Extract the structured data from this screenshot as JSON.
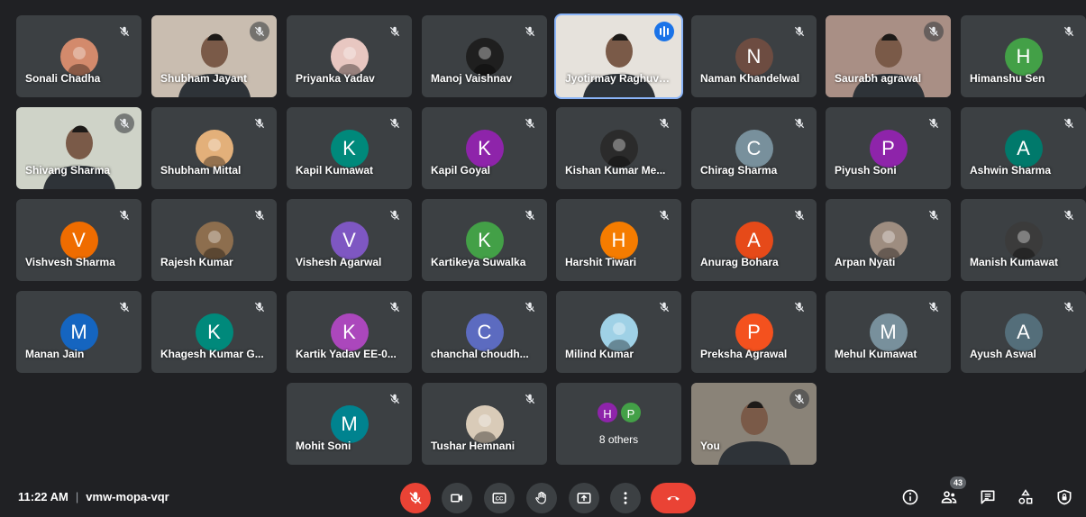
{
  "participants": [
    {
      "name": "Sonali Chadha",
      "kind": "photo",
      "avatar_bg": "#d38a6c",
      "muted": true
    },
    {
      "name": "Shubham Jayant",
      "kind": "video",
      "video_bg": "#c9bdb0",
      "muted": true
    },
    {
      "name": "Priyanka Yadav",
      "kind": "photo",
      "avatar_bg": "#e8c7c1",
      "muted": true
    },
    {
      "name": "Manoj Vaishnav",
      "kind": "photo",
      "avatar_bg": "#1f1f1f",
      "muted": true
    },
    {
      "name": "Jyotirmay Raghuvanshi",
      "kind": "video",
      "video_bg": "#e6e2dc",
      "muted": false,
      "speaking": true
    },
    {
      "name": "Naman Khandelwal",
      "kind": "initial",
      "initial": "N",
      "avatar_bg": "#6d4c41",
      "muted": true
    },
    {
      "name": "Saurabh agrawal",
      "kind": "video",
      "video_bg": "#a98f85",
      "muted": true
    },
    {
      "name": "Himanshu Sen",
      "kind": "initial",
      "initial": "H",
      "avatar_bg": "#43a047",
      "muted": true
    },
    {
      "name": "Shivang Sharma",
      "kind": "video",
      "video_bg": "#cfd3c8",
      "muted": true
    },
    {
      "name": "Shubham Mittal",
      "kind": "photo",
      "avatar_bg": "#e3b07a",
      "muted": true
    },
    {
      "name": "Kapil Kumawat",
      "kind": "initial",
      "initial": "K",
      "avatar_bg": "#00897b",
      "muted": true
    },
    {
      "name": "Kapil Goyal",
      "kind": "initial",
      "initial": "K",
      "avatar_bg": "#8e24aa",
      "muted": true
    },
    {
      "name": "Kishan Kumar Me...",
      "kind": "photo",
      "avatar_bg": "#2b2b2b",
      "muted": true
    },
    {
      "name": "Chirag Sharma",
      "kind": "initial",
      "initial": "C",
      "avatar_bg": "#78909c",
      "muted": true
    },
    {
      "name": "Piyush Soni",
      "kind": "initial",
      "initial": "P",
      "avatar_bg": "#8e24aa",
      "muted": true
    },
    {
      "name": "Ashwin Sharma",
      "kind": "initial",
      "initial": "A",
      "avatar_bg": "#00796b",
      "muted": true
    },
    {
      "name": "Vishvesh Sharma",
      "kind": "initial",
      "initial": "V",
      "avatar_bg": "#ef6c00",
      "muted": true
    },
    {
      "name": "Rajesh Kumar",
      "kind": "photo",
      "avatar_bg": "#8d6e4e",
      "muted": true
    },
    {
      "name": "Vishesh Agarwal",
      "kind": "initial",
      "initial": "V",
      "avatar_bg": "#7e57c2",
      "muted": true
    },
    {
      "name": "Kartikeya Suwalka",
      "kind": "initial",
      "initial": "K",
      "avatar_bg": "#43a047",
      "muted": true
    },
    {
      "name": "Harshit Tiwari",
      "kind": "initial",
      "initial": "H",
      "avatar_bg": "#f57c00",
      "muted": true
    },
    {
      "name": "Anurag Bohara",
      "kind": "initial",
      "initial": "A",
      "avatar_bg": "#e64a19",
      "muted": true
    },
    {
      "name": "Arpan Nyati",
      "kind": "photo",
      "avatar_bg": "#9e8d80",
      "muted": true
    },
    {
      "name": "Manish Kumawat",
      "kind": "photo",
      "avatar_bg": "#3b3b3b",
      "muted": true
    },
    {
      "name": "Manan Jain",
      "kind": "initial",
      "initial": "M",
      "avatar_bg": "#1565c0",
      "muted": true
    },
    {
      "name": "Khagesh Kumar G...",
      "kind": "initial",
      "initial": "K",
      "avatar_bg": "#00897b",
      "muted": true
    },
    {
      "name": "Kartik Yadav EE-0...",
      "kind": "initial",
      "initial": "K",
      "avatar_bg": "#ab47bc",
      "muted": true
    },
    {
      "name": "chanchal choudh...",
      "kind": "initial",
      "initial": "C",
      "avatar_bg": "#5c6bc0",
      "muted": true
    },
    {
      "name": "Milind Kumar",
      "kind": "photo",
      "avatar_bg": "#9fd1e6",
      "muted": true
    },
    {
      "name": "Preksha Agrawal",
      "kind": "initial",
      "initial": "P",
      "avatar_bg": "#f4511e",
      "muted": true
    },
    {
      "name": "Mehul Kumawat",
      "kind": "initial",
      "initial": "M",
      "avatar_bg": "#78909c",
      "muted": true
    },
    {
      "name": "Ayush Aswal",
      "kind": "initial",
      "initial": "A",
      "avatar_bg": "#546e7a",
      "muted": true
    },
    {
      "name": "Mohit Soni",
      "kind": "initial",
      "initial": "M",
      "avatar_bg": "#00838f",
      "muted": true
    },
    {
      "name": "Tushar Hemnani",
      "kind": "photo",
      "avatar_bg": "#d9cbb8",
      "muted": true
    }
  ],
  "others_tile": {
    "label": "8 others",
    "chips": [
      {
        "initial": "H",
        "color": "#8e24aa"
      },
      {
        "initial": "P",
        "color": "#43a047"
      }
    ]
  },
  "self_tile": {
    "name": "You",
    "video_bg": "#8a8378",
    "muted": true
  },
  "meeting": {
    "time": "11:22 AM",
    "separator": "|",
    "code": "vmw-mopa-vqr"
  },
  "controls": [
    {
      "id": "mic-toggle",
      "icon": "mic-off-icon",
      "style": "red"
    },
    {
      "id": "camera-toggle",
      "icon": "camera-icon",
      "style": "normal"
    },
    {
      "id": "captions-toggle",
      "icon": "captions-icon",
      "style": "normal"
    },
    {
      "id": "raise-hand",
      "icon": "hand-icon",
      "style": "normal"
    },
    {
      "id": "present-screen",
      "icon": "present-icon",
      "style": "normal"
    },
    {
      "id": "more-options",
      "icon": "more-vert-icon",
      "style": "normal"
    },
    {
      "id": "leave-call",
      "icon": "end-call-icon",
      "style": "end"
    }
  ],
  "side_controls": [
    {
      "id": "meeting-details",
      "icon": "info-icon"
    },
    {
      "id": "people",
      "icon": "people-icon",
      "badge": "43"
    },
    {
      "id": "chat",
      "icon": "chat-icon"
    },
    {
      "id": "activities",
      "icon": "activities-icon"
    },
    {
      "id": "host-controls",
      "icon": "shield-lock-icon"
    }
  ],
  "colors": {
    "background": "#202124",
    "tile": "#3c4043",
    "red": "#ea4335",
    "speaking": "#8ab4f8"
  }
}
